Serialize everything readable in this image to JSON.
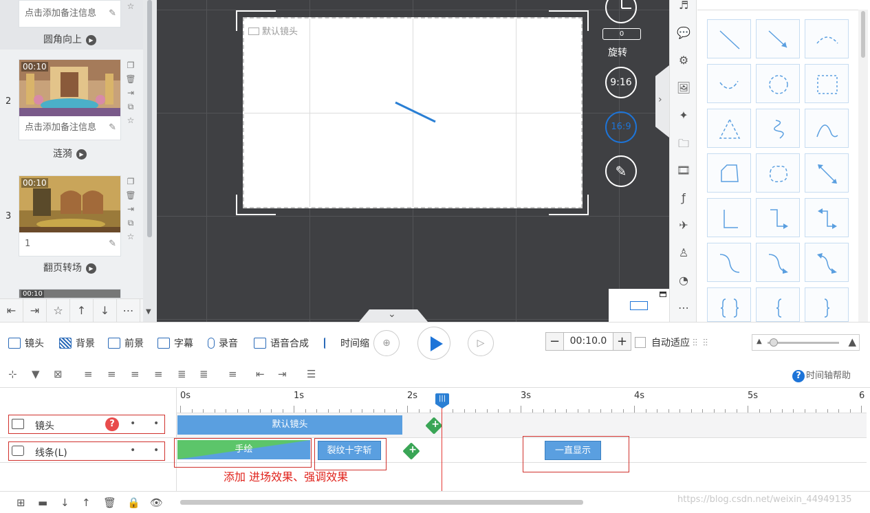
{
  "scenes": [
    {
      "num": "",
      "duration": "",
      "note": "点击添加备注信息",
      "title": "圆角向上"
    },
    {
      "num": "2",
      "duration": "00:10",
      "note": "点击添加备注信息",
      "title": "涟漪"
    },
    {
      "num": "3",
      "duration": "00:10",
      "note": "1",
      "title": "翻页转场"
    },
    {
      "num": "",
      "duration": "00:10",
      "note": "",
      "title": ""
    }
  ],
  "canvas": {
    "camera_label": "默认镜头",
    "rotate_value": "0",
    "rotate_label": "旋转",
    "ratio_portrait": "9:16",
    "ratio_landscape": "16:9"
  },
  "toolbar": {
    "camera": "镜头",
    "background": "背景",
    "foreground": "前景",
    "subtitle": "字幕",
    "record": "录音",
    "tts": "语音合成",
    "time_scale": "时间缩",
    "duration_value": "00:10.0",
    "auto_fit": "自动适应"
  },
  "help": {
    "label": "时间轴帮助"
  },
  "timeline": {
    "ticks": [
      "0s",
      "1s",
      "2s",
      "3s",
      "4s",
      "5s",
      "6"
    ],
    "tracks": [
      {
        "name": "镜头"
      },
      {
        "name": "线条(L)"
      }
    ],
    "clips": {
      "default_camera": "默认镜头",
      "hand_draw": "手绘",
      "crack_cross": "裂纹十字斩",
      "always_show": "一直显示"
    },
    "playhead_label": "|||",
    "annotation": "添加 进场效果、强调效果"
  },
  "watermark": "https://blog.csdn.net/weixin_44949135",
  "colors": {
    "accent": "#1d74d8",
    "clip_blue": "#5a9fe0",
    "clip_green": "#5cc56a",
    "annotation_red": "#e0221b",
    "canvas_bg": "#3f4043"
  }
}
